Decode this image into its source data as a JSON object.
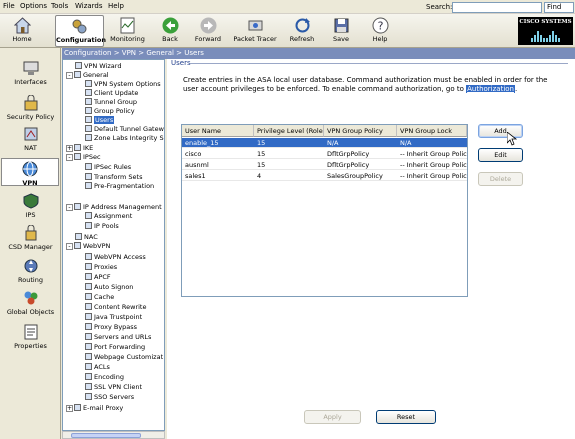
{
  "menu": {
    "items": [
      "File",
      "Options",
      "Tools",
      "Wizards",
      "Help"
    ],
    "search_label": "Search:",
    "find_label": "Find",
    "search_value": ""
  },
  "toolbar": {
    "home": "Home",
    "configuration": "Configuration",
    "monitoring": "Monitoring",
    "back": "Back",
    "forward": "Forward",
    "packet_tracer": "Packet Tracer",
    "refresh": "Refresh",
    "save": "Save",
    "help": "Help"
  },
  "brand": {
    "logo_text": "CISCO SYSTEMS"
  },
  "leftnav": {
    "items": [
      "Interfaces",
      "Security Policy",
      "NAT",
      "VPN",
      "IPS",
      "CSD Manager",
      "Routing",
      "Global Objects",
      "Properties"
    ]
  },
  "breadcrumb": "Configuration > VPN > General > Users",
  "tree": {
    "vpn_wizard": "VPN Wizard",
    "general": "General",
    "vpn_system_options": "VPN System Options",
    "client_update": "Client Update",
    "tunnel_group": "Tunnel Group",
    "group_policy": "Group Policy",
    "users": "Users",
    "default_tunnel_gateway": "Default Tunnel Gatew",
    "zone_labs": "Zone Labs Integrity S",
    "ike": "IKE",
    "ipsec": "IPSec",
    "ipsec_rules": "IPSec Rules",
    "transform_sets": "Transform Sets",
    "pre_fragmentation": "Pre-Fragmentation",
    "ip_address_management": "IP Address Management",
    "assignment": "Assignment",
    "ip_pools": "IP Pools",
    "nac": "NAC",
    "webvpn": "WebVPN",
    "webvpn_access": "WebVPN Access",
    "proxies": "Proxies",
    "apcf": "APCF",
    "auto_signon": "Auto Signon",
    "cache": "Cache",
    "content_rewrite": "Content Rewrite",
    "java_trustpoint": "Java Trustpoint",
    "proxy_bypass": "Proxy Bypass",
    "servers_and_urls": "Servers and URLs",
    "port_forwarding": "Port Forwarding",
    "webpage_customization": "Webpage Customizat",
    "acls": "ACLs",
    "encoding": "Encoding",
    "ssl_vpn_client": "SSL VPN Client",
    "sso_servers": "SSO Servers",
    "email_proxy": "E-mail Proxy"
  },
  "panel": {
    "title": "Users",
    "description": "Create entries in the ASA local user database. Command authorization must be enabled in order for the user account privileges to be enforced. To enable command authorization, go to",
    "link": "Authorization",
    "period": "."
  },
  "table": {
    "columns": [
      "User Name",
      "Privilege Level (Role)",
      "VPN Group Policy",
      "VPN Group Lock"
    ],
    "rows": [
      [
        "enable_15",
        "15",
        "N/A",
        "N/A"
      ],
      [
        "cisco",
        "15",
        "DfltGrpPolicy",
        "-- Inherit Group Polic..."
      ],
      [
        "ausnml",
        "15",
        "DfltGrpPolicy",
        "-- Inherit Group Polic..."
      ],
      [
        "sales1",
        "4",
        "SalesGroupPolicy",
        "-- Inherit Group Polic..."
      ]
    ],
    "selected_row": 0
  },
  "buttons": {
    "add": "Add",
    "edit": "Edit",
    "delete": "Delete",
    "apply": "Apply",
    "reset": "Reset"
  }
}
